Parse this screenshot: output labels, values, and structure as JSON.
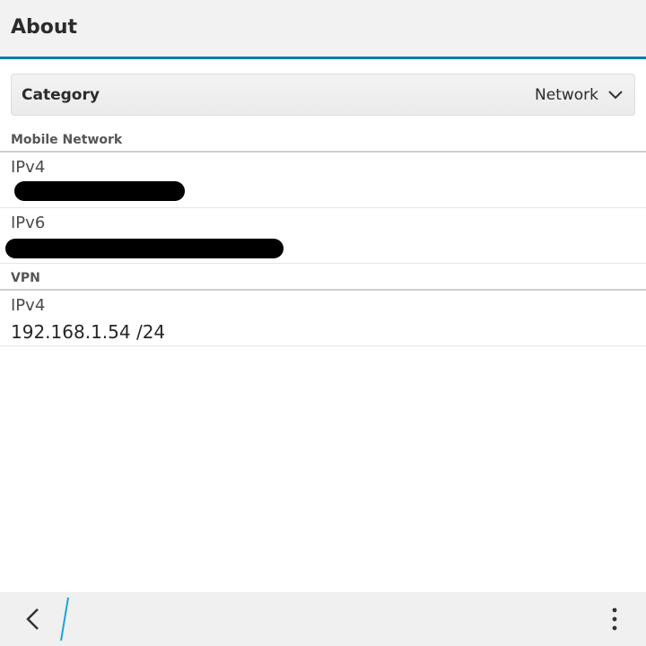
{
  "header": {
    "title": "About"
  },
  "category": {
    "label": "Category",
    "selected": "Network"
  },
  "sections": {
    "mobile_network": {
      "title": "Mobile Network",
      "items": [
        {
          "label": "IPv4"
        },
        {
          "label": "IPv6"
        }
      ]
    },
    "vpn": {
      "title": "VPN",
      "items": [
        {
          "label": "IPv4",
          "value": "192.168.1.54 /24"
        }
      ]
    }
  },
  "icons": {
    "back": "chevron-left-icon",
    "overflow": "more-vertical-icon",
    "dropdown": "chevron-down-icon"
  },
  "colors": {
    "accent": "#0b7ea7",
    "background": "#ffffff",
    "bar": "#f0f0f0"
  }
}
